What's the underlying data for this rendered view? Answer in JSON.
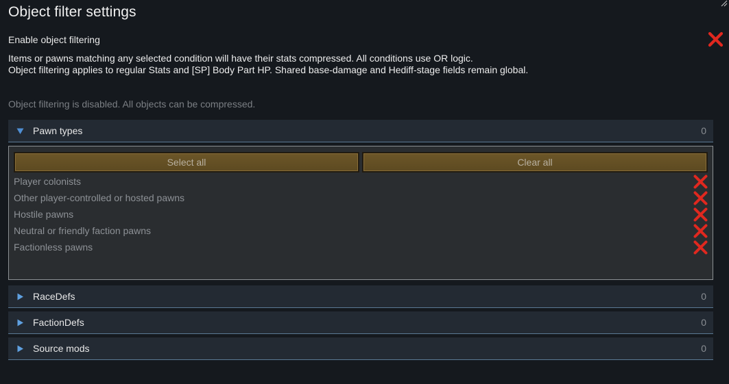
{
  "window": {
    "title": "Object filter settings"
  },
  "enable": {
    "label": "Enable object filtering",
    "state": "off",
    "icon": "red-x-icon"
  },
  "description": {
    "line1": "Items or pawns matching any selected condition will have their stats compressed. All conditions use OR logic.",
    "line2": "Object filtering applies to regular Stats and [SP] Body Part HP. Shared base-damage and Hediff-stage fields remain global."
  },
  "status_text": "Object filtering is disabled. All objects can be compressed.",
  "sections": [
    {
      "label": "Pawn types",
      "count": "0",
      "expanded": true
    },
    {
      "label": "RaceDefs",
      "count": "0",
      "expanded": false
    },
    {
      "label": "FactionDefs",
      "count": "0",
      "expanded": false
    },
    {
      "label": "Source mods",
      "count": "0",
      "expanded": false
    }
  ],
  "pawn_panel": {
    "select_all_label": "Select all",
    "clear_all_label": "Clear all",
    "items": [
      {
        "label": "Player colonists",
        "state": "off"
      },
      {
        "label": "Other player-controlled or hosted pawns",
        "state": "off"
      },
      {
        "label": "Hostile pawns",
        "state": "off"
      },
      {
        "label": "Neutral or friendly faction pawns",
        "state": "off"
      },
      {
        "label": "Factionless pawns",
        "state": "off"
      }
    ]
  },
  "colors": {
    "background": "#15191e",
    "section_bg": "#232a33",
    "section_border": "#5b7a95",
    "expanded_arrow": "#4f8fd4",
    "collapsed_arrow": "#5fa0e0",
    "button_bg": "#6c5628",
    "x_red": "#e0281f"
  }
}
